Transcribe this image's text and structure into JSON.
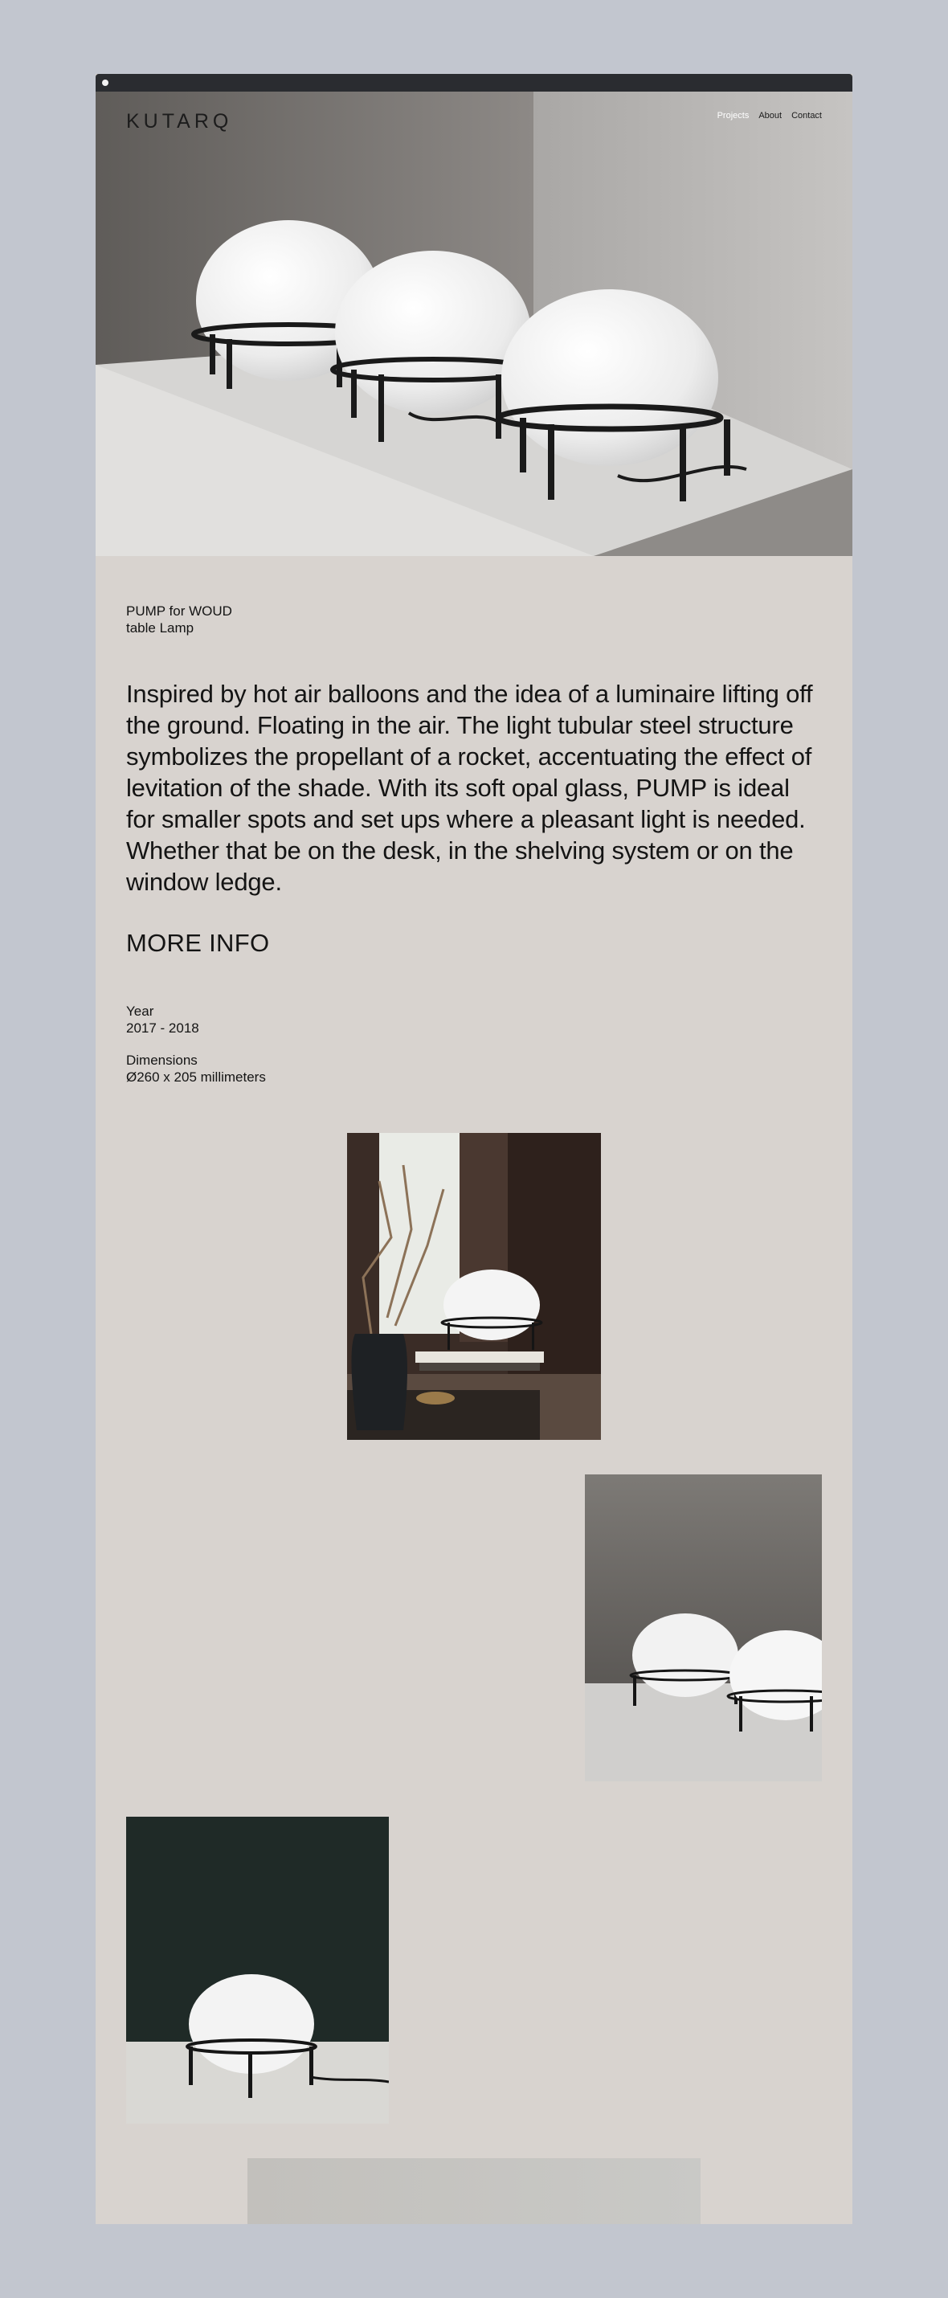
{
  "header": {
    "logo": "KUTARQ",
    "nav": [
      {
        "label": "Projects",
        "active": true
      },
      {
        "label": "About",
        "active": false
      },
      {
        "label": "Contact",
        "active": false
      }
    ]
  },
  "project": {
    "title_line1": "PUMP for WOUD",
    "title_line2": "table Lamp",
    "description": "Inspired by hot air balloons and the idea of a luminaire lifting off the ground. Floating in the air. The light tubular steel structure symbolizes the propellant of a rocket, accentuating the effect of levitation of the shade. With its soft opal glass, PUMP is ideal for smaller spots and set ups where a pleasant light is needed. Whether that be on the desk, in the shelving system or on the window ledge.",
    "more_info": "MORE INFO",
    "specs": [
      {
        "label": "Year",
        "value": "2017 - 2018"
      },
      {
        "label": "Dimensions",
        "value": "Ø260 x 205 millimeters"
      }
    ]
  },
  "colors": {
    "page_background": "#c2c6cf",
    "content_background": "#d8d3cf",
    "titlebar": "#2a2c30",
    "text": "#141414"
  }
}
